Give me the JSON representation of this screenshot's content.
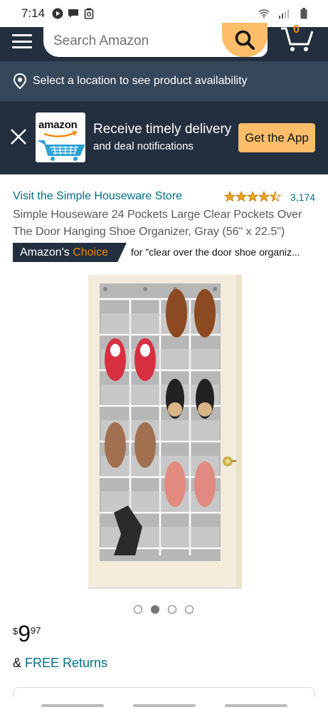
{
  "status_bar": {
    "time": "7:14"
  },
  "header": {
    "search_placeholder": "Search Amazon",
    "cart_count": "0"
  },
  "location_bar": {
    "text": "Select a location to see product availability"
  },
  "app_banner": {
    "logo_text": "amazon",
    "title": "Receive timely delivery",
    "subtitle": "and deal notifications",
    "button_label": "Get the App"
  },
  "product": {
    "store_link": "Visit the Simple Houseware Store",
    "rating_stars": 4.5,
    "rating_count": "3,174",
    "title": "Simple Houseware 24 Pockets Large Clear Pockets Over The Door Hanging Shoe Organizer, Gray (56\" x 22.5\")",
    "badge_part1": "Amazon's",
    "badge_part2": "Choice",
    "badge_for": "for \"clear over the door shoe organiz...",
    "image_count": 4,
    "active_image_index": 1,
    "price_currency": "$",
    "price_whole": "9",
    "price_fraction": "97",
    "returns_prefix": "& ",
    "returns_link": "FREE Returns"
  },
  "colors": {
    "header_bg": "#232f3e",
    "location_bg": "#37475a",
    "accent": "#febd69",
    "link": "#007185",
    "choice_orange": "#f08804"
  }
}
